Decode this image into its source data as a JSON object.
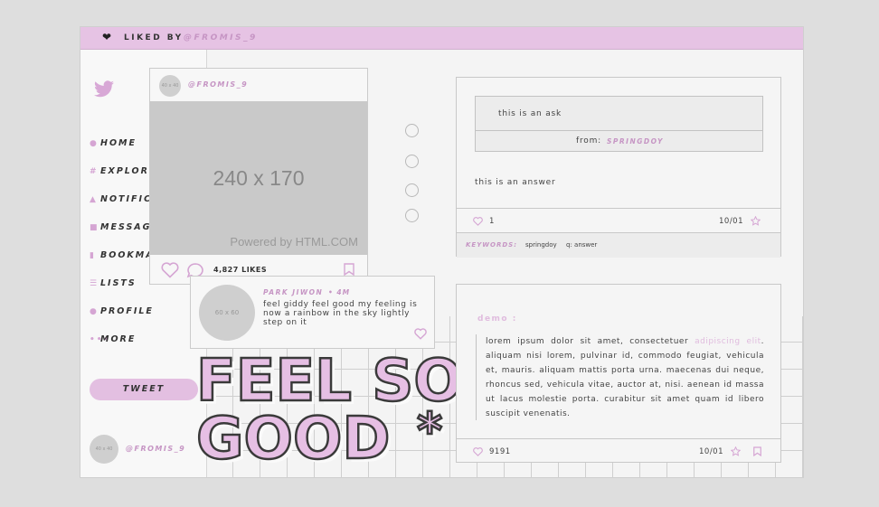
{
  "topbar": {
    "label": "LIKED BY",
    "user": "@FROMIS_9"
  },
  "sidebar": {
    "items": [
      {
        "label": "HOME",
        "icon": "home-icon"
      },
      {
        "label": "EXPLORE",
        "icon": "hash-icon"
      },
      {
        "label": "NOTIFICA",
        "icon": "bell-icon"
      },
      {
        "label": "MESSAGE",
        "icon": "envelope-icon"
      },
      {
        "label": "BOOKMA",
        "icon": "bookmark-icon"
      },
      {
        "label": "LISTS",
        "icon": "list-icon"
      },
      {
        "label": "PROFILE",
        "icon": "person-icon"
      },
      {
        "label": "MORE",
        "icon": "dots-icon"
      }
    ],
    "tweet_label": "TWEET",
    "avatar_text": "40 x 40",
    "user": "@FROMIS_9"
  },
  "insta": {
    "avatar_text": "40 x 40",
    "user": "@FROMIS_9",
    "image_text": "240 x 170",
    "powered_text": "Powered by HTML.COM",
    "likes": "4,827 LIKES"
  },
  "comment": {
    "avatar_text": "60 x 60",
    "name": "PARK JIWON",
    "time": "• 4M",
    "text": "feel giddy feel good my feeling is now a rainbow in the sky lightly step on it"
  },
  "headline": {
    "line1": "FEEL SO",
    "line2": "GOOD",
    "star": "*"
  },
  "ask_card": {
    "question": "this is an ask",
    "from_label": "from:",
    "from_user": "SPRINGDOY",
    "answer": "this is an answer",
    "like_count": "1",
    "date": "10/01",
    "keywords_label": "KEYWORDS:",
    "keywords": [
      "springdoy",
      "q: answer"
    ]
  },
  "demo_card": {
    "title": "demo :",
    "text_before": "lorem ipsum dolor sit amet, consectetuer",
    "highlight": "adipiscing elit",
    "text_after": ". aliquam nisi lorem, pulvinar id, commodo feugiat, vehicula et, mauris. aliquam mattis porta urna. maecenas dui neque, rhoncus sed, vehicula vitae, auctor at, nisi. aenean id massa ut lacus molestie porta. curabitur sit amet quam id libero suscipit venenatis.",
    "like_count": "9191",
    "date": "10/01"
  },
  "colors": {
    "accent": "#e6c3e4",
    "accent_text": "#c695c4",
    "bg": "#dedede",
    "panel": "#f4f4f4"
  }
}
